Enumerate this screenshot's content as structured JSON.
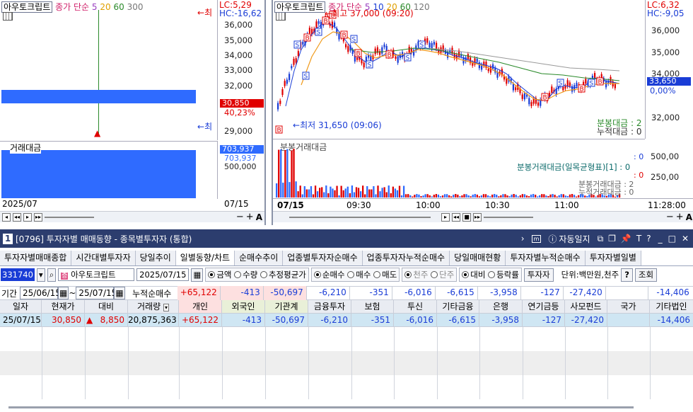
{
  "left_chart": {
    "stock_name": "아우토크립트",
    "indicators": [
      "종가",
      "단순",
      "5",
      "20",
      "60",
      "300"
    ],
    "lc": "LC:5,29",
    "hc": "HC:-16,62",
    "high_marker": "최",
    "low_marker": "최",
    "y_ticks": [
      "36,000",
      "35,000",
      "34,000",
      "33,000",
      "32,000",
      "31,000",
      "29,000"
    ],
    "price_tag": "30,850",
    "pct_tag": "40,23%",
    "volume_label": "거래대금",
    "vol_tag": "703,937",
    "vol_tag2": "703,937",
    "vol_tick": "500,000",
    "date_left": "2025/07",
    "date_right": "07/15"
  },
  "right_chart": {
    "stock_name": "아우토크립트",
    "indicators": [
      "종가",
      "단순",
      "5",
      "10",
      "20",
      "60",
      "120"
    ],
    "high_label": "최고 37,000 (09:20)",
    "low_label": "최저 31,650 (09:06)",
    "lc": "LC:6,32",
    "hc": "HC:-9,05",
    "y_ticks": [
      "36,000",
      "35,000",
      "34,000",
      "33,000",
      "32,000"
    ],
    "price_tag": "33,650",
    "pct_tag": "0,00%",
    "split_label": "분봉대금 : 2",
    "cum_label": "누적대금 : 0",
    "vol_title": "분봉거래대금",
    "vol_ticks": [
      "500,00",
      "250,00"
    ],
    "ichimoku_label": "분봉거래대금(일목균형표)[1] : 0",
    "lines": [
      ": 0",
      ": 0",
      "분봉거래대금 : 2",
      "누적거래대금 : 0"
    ],
    "x_labels": [
      "07/15",
      "09:30",
      "10:00",
      "10:30",
      "11:00",
      "11:28:00"
    ]
  },
  "window": {
    "num": "1",
    "title": "[0796] 투자자별 매매동향 - 종목별투자자 (통합)",
    "auto_label": "자동일지",
    "tabs": [
      "투자자별매매종합",
      "시간대별투자자",
      "당일추이",
      "일별동향/차트",
      "순매수추이",
      "업종별투자자순매수",
      "업종투자자누적순매수",
      "당일매매현황",
      "투자자별누적순매수",
      "투자자별일별"
    ]
  },
  "controls": {
    "code": "331740",
    "name": "아우토크립트",
    "date": "2025/07/15",
    "r1": [
      "금액",
      "수량",
      "추정평균가"
    ],
    "r2": [
      "순매수",
      "매수",
      "매도"
    ],
    "r3": [
      "천주",
      "단주"
    ],
    "r4": [
      "대비",
      "등락률"
    ],
    "investor_btn": "투자자",
    "unit": "단위:백만원,천주",
    "help": "?",
    "query": "조회"
  },
  "period": {
    "label": "기간",
    "from": "25/06/15",
    "tilde": "~",
    "to": "25/07/15",
    "sum_label": "누적순매수",
    "values": [
      "+65,122",
      "-413",
      "-50,697",
      "-6,210",
      "-351",
      "-6,016",
      "-6,615",
      "-3,958",
      "-127",
      "-27,420",
      "",
      "-14,406"
    ]
  },
  "table": {
    "headers": [
      "일자",
      "현재가",
      "대비",
      "거래량",
      "개인",
      "외국인",
      "기관계",
      "금융투자",
      "보험",
      "투신",
      "기타금융",
      "은행",
      "연기금등",
      "사모펀드",
      "국가",
      "기타법인"
    ],
    "rows": [
      [
        "25/07/15",
        "30,850",
        "8,850",
        "20,875,363",
        "+65,122",
        "-413",
        "-50,697",
        "-6,210",
        "-351",
        "-6,016",
        "-6,615",
        "-3,958",
        "-127",
        "-27,420",
        "",
        "-14,406"
      ]
    ]
  },
  "colors": {
    "header_bg": "#2c3d6e",
    "blue": "#2f6bff",
    "red": "#e00000",
    "ma5": "#f09a1a",
    "ma20": "#2a8a2a"
  }
}
